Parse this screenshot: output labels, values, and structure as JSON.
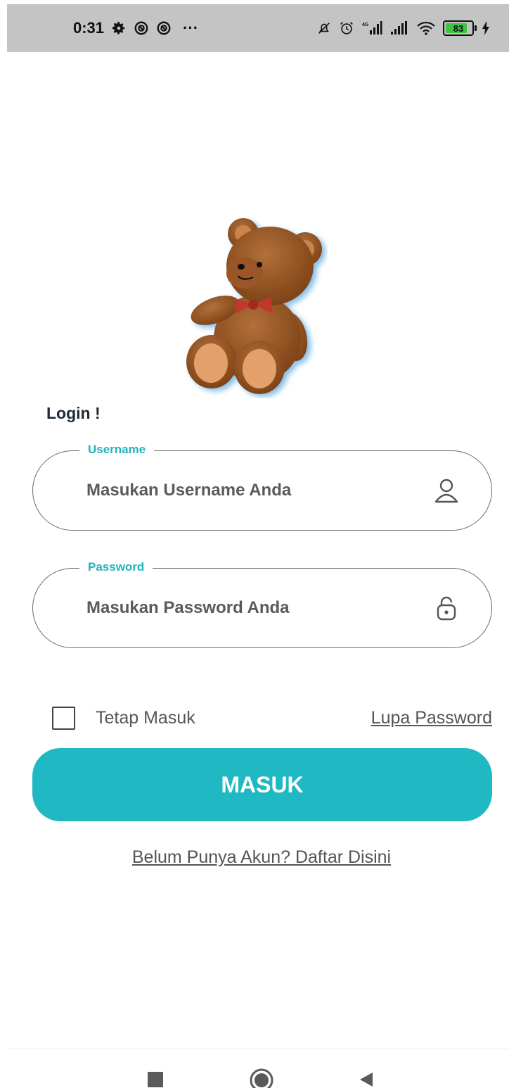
{
  "status_bar": {
    "time": "0:31",
    "more": "···",
    "battery_level": "83",
    "battery_percent": 83,
    "icons_left": [
      "gear-icon",
      "vpn-icon",
      "vpn-icon"
    ],
    "icons_right": [
      "bell-off-icon",
      "alarm-icon",
      "signal-4g-icon",
      "signal-icon",
      "wifi-icon",
      "battery-icon",
      "charging-icon"
    ]
  },
  "login": {
    "title": "Login !",
    "username": {
      "label": "Username",
      "placeholder": "Masukan Username Anda",
      "icon": "user-icon"
    },
    "password": {
      "label": "Password",
      "placeholder": "Masukan Password Anda",
      "icon": "lock-icon"
    },
    "remember_label": "Tetap Masuk",
    "forgot_link": "Lupa Password",
    "submit_label": "MASUK",
    "register_link": "Belum Punya Akun? Daftar Disini"
  },
  "nav_bar": {
    "buttons": [
      "recents-icon",
      "home-icon",
      "back-icon"
    ]
  },
  "colors": {
    "accent": "#1fb8c3",
    "status_bar_bg": "#c4c4c4"
  }
}
